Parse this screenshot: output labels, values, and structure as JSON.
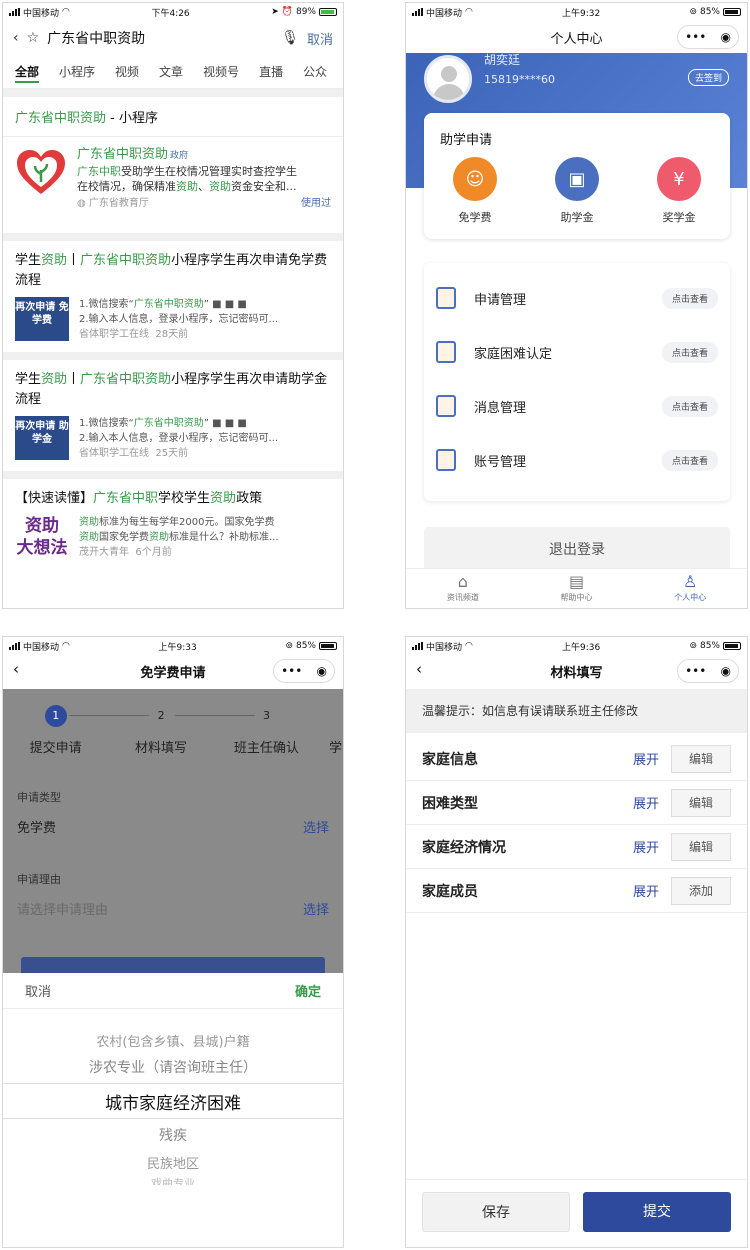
{
  "s1": {
    "status": {
      "carrier": "中国移动",
      "time": "下午4:26",
      "battery": "89%"
    },
    "search": {
      "query": "广东省中职资助",
      "cancel": "取消"
    },
    "tabs": [
      "全部",
      "小程序",
      "视频",
      "文章",
      "视频号",
      "直播",
      "公众"
    ],
    "section": {
      "name": "广东省中职资助",
      "suffix": " - 小程序"
    },
    "mini": {
      "title": "广东省中职资助",
      "tag": "政府",
      "desc1_hl": "广东中职",
      "desc1": "受助学生在校情况管理实时查控学生",
      "desc2_a": "在校情况，确保精准",
      "desc2_hl1": "资助",
      "desc2_b": "、",
      "desc2_hl2": "资助",
      "desc2_c": "资金安全和...",
      "source": "广东省教育厅",
      "use": "使用过"
    },
    "articles": [
      {
        "t1": "学生",
        "t2": "资助",
        "t3": "丨",
        "t4": "广东省中职资助",
        "t5": "小程序学生再次申请免学费流程",
        "thumb": "再次申请 免学费",
        "l1a": "1.微信搜索“",
        "l1b": "广东省中职资助",
        "l1c": "” ■ ■ ■",
        "l2": "2.输入本人信息，登录小程序，忘记密码可...",
        "src": "省体职学工在线",
        "ago": "28天前"
      },
      {
        "t1": "学生",
        "t2": "资助",
        "t3": "丨",
        "t4": "广东省中职资助",
        "t5": "小程序学生再次申请助学金流程",
        "thumb": "再次申请 助学金",
        "l1a": "1.微信搜索“",
        "l1b": "广东省中职资助",
        "l1c": "” ■ ■ ■",
        "l2": "2.输入本人信息，登录小程序，忘记密码可...",
        "src": "省体职学工在线",
        "ago": "25天前"
      }
    ],
    "article3": {
      "t1": "【快速读懂】",
      "t2": "广东省中职",
      "t3": "学校学生",
      "t4": "资助",
      "t5": "政策",
      "thumb1": "资助",
      "thumb2": "大想法",
      "l1a": "资助",
      "l1b": "标准为每生每学年2000元。国家免学费",
      "l2a": "资助",
      "l2b": "国家免学费",
      "l2c": "资助",
      "l2d": "标准是什么？补助标准...",
      "src": "茂开大青年",
      "ago": "6个月前"
    }
  },
  "s2": {
    "status": {
      "carrier": "中国移动",
      "time": "上午9:32",
      "battery": "85%"
    },
    "nav_title": "个人中心",
    "user": {
      "name": "胡奕廷",
      "phone": "15819****60",
      "signin": "去签到"
    },
    "apply": {
      "title": "助学申请",
      "items": [
        "免学费",
        "助学金",
        "奖学金"
      ]
    },
    "menu": [
      {
        "label": "申请管理",
        "btn": "点击查看"
      },
      {
        "label": "家庭困难认定",
        "btn": "点击查看"
      },
      {
        "label": "消息管理",
        "btn": "点击查看"
      },
      {
        "label": "账号管理",
        "btn": "点击查看"
      }
    ],
    "logout": "退出登录",
    "tabbar": [
      "资讯频道",
      "帮助中心",
      "个人中心"
    ]
  },
  "s3": {
    "status": {
      "carrier": "中国移动",
      "time": "上午9:33",
      "battery": "85%"
    },
    "nav_title": "免学费申请",
    "steps": [
      {
        "num": "1",
        "label": "提交申请"
      },
      {
        "num": "2",
        "label": "材料填写"
      },
      {
        "num": "3",
        "label": "班主任确认"
      },
      {
        "num": "4",
        "label": "学"
      }
    ],
    "type_label": "申请类型",
    "type_value": "免学费",
    "reason_label": "申请理由",
    "reason_placeholder": "请选择申请理由",
    "choose": "选择",
    "sheet_cancel": "取消",
    "sheet_confirm": "确定",
    "options": [
      "农村(包含乡镇、县城)户籍",
      "涉农专业（请咨询班主任）",
      "城市家庭经济困难",
      "残疾",
      "民族地区",
      "戏曲专业"
    ]
  },
  "s4": {
    "status": {
      "carrier": "中国移动",
      "time": "上午9:36",
      "battery": "85%"
    },
    "nav_title": "材料填写",
    "tip": "温馨提示：如信息有误请联系班主任修改",
    "rows": [
      {
        "label": "家庭信息",
        "expand": "展开",
        "action": "编辑"
      },
      {
        "label": "困难类型",
        "expand": "展开",
        "action": "编辑"
      },
      {
        "label": "家庭经济情况",
        "expand": "展开",
        "action": "编辑"
      },
      {
        "label": "家庭成员",
        "expand": "展开",
        "action": "添加"
      }
    ],
    "save": "保存",
    "submit": "提交"
  }
}
